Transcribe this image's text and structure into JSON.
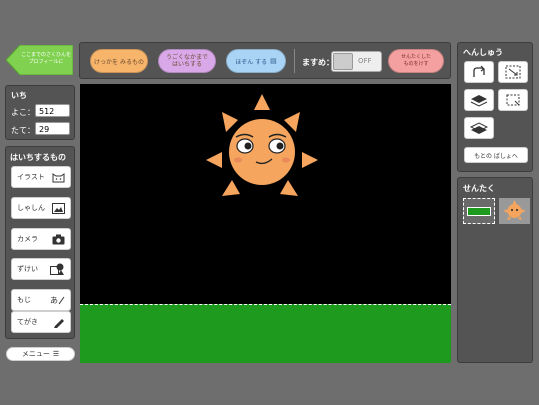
{
  "back_button": {
    "line1": "ここまでのさくひんを",
    "line2": "プロフィールに",
    "color": "#7fd14f"
  },
  "toolbar": {
    "btn_look": "けっかを みるもの",
    "btn_move_line1": "うごくなかまで",
    "btn_move_line2": "はいちする",
    "btn_save": "ほぞん する",
    "grid_label": "ますめ：",
    "grid_toggle": "OFF",
    "btn_undo_line1": "せんたくした",
    "btn_undo_line2": "ものをけす"
  },
  "position": {
    "title": "いち",
    "x_label": "よこ：",
    "x_value": "512",
    "y_label": "たて：",
    "y_value": "29"
  },
  "place": {
    "title": "はいちするもの",
    "items": [
      "イラスト",
      "しゃしん",
      "カメラ",
      "ずけい",
      "もじ",
      "てがき"
    ]
  },
  "menu_button": "メニュー",
  "edit": {
    "title": "へんしゅう",
    "reset_button": "もとの ばしょへ"
  },
  "select": {
    "title": "せんたく"
  },
  "colors": {
    "canvas": "#000000",
    "grass": "#1e9a1e",
    "sun": "#f5a55e",
    "look": "#f7b56b",
    "move": "#d9a8e8",
    "save": "#a9d4f5",
    "undo": "#f5a0a0"
  }
}
